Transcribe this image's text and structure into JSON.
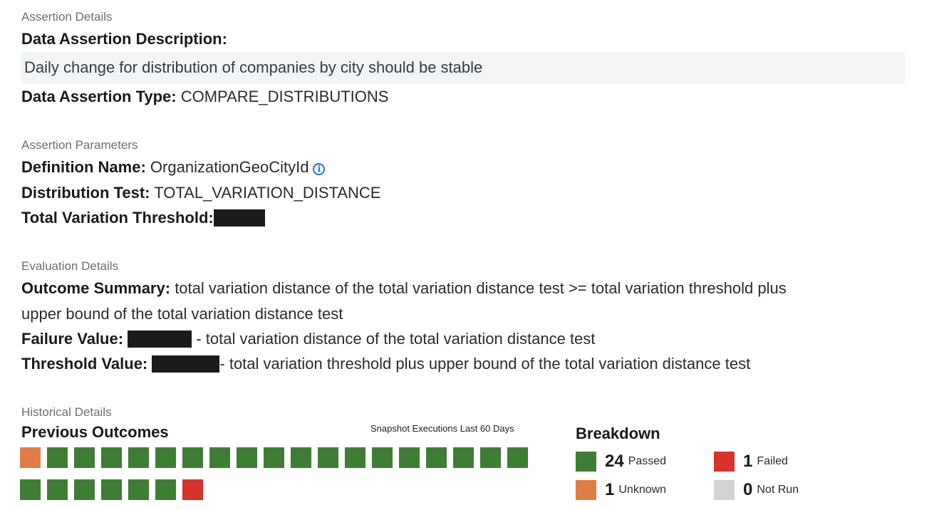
{
  "assertion": {
    "section_label": "Assertion Details",
    "description_label": "Data Assertion Description:",
    "description_text": "Daily change for distribution of companies by city should be stable",
    "type_label": "Data Assertion Type:",
    "type_value": "COMPARE_DISTRIBUTIONS"
  },
  "parameters": {
    "section_label": "Assertion Parameters",
    "definition_label": "Definition Name:",
    "definition_value": "OrganizationGeoCityId",
    "info_icon": "info-icon",
    "dist_label": "Distribution Test:",
    "dist_value": "TOTAL_VARIATION_DISTANCE",
    "threshold_label": "Total Variation Threshold:"
  },
  "evaluation": {
    "section_label": "Evaluation Details",
    "summary_label": "Outcome Summary:",
    "summary_value": "total variation distance of the total variation distance test >= total variation threshold plus",
    "summary_value_cont": "upper bound of the total variation distance test",
    "failure_label": "Failure Value:",
    "failure_value": "- total variation distance of the total variation distance test",
    "threshold_label": "Threshold Value:",
    "threshold_value": "- total variation threshold plus upper bound of the total variation distance test"
  },
  "history": {
    "section_label": "Historical Details",
    "title": "Previous Outcomes",
    "snapshot_label": "Snapshot Executions Last 60 Days",
    "outcomes": [
      "unknown",
      "passed",
      "passed",
      "passed",
      "passed",
      "passed",
      "passed",
      "passed",
      "passed",
      "passed",
      "passed",
      "passed",
      "passed",
      "passed",
      "passed",
      "passed",
      "passed",
      "passed",
      "passed",
      "passed",
      "passed",
      "passed",
      "passed",
      "passed",
      "passed",
      "failed"
    ]
  },
  "breakdown": {
    "title": "Breakdown",
    "passed": {
      "count": "24",
      "label": "Passed"
    },
    "failed": {
      "count": "1",
      "label": "Failed"
    },
    "unknown": {
      "count": "1",
      "label": "Unknown"
    },
    "not_run": {
      "count": "0",
      "label": "Not Run"
    }
  },
  "colors": {
    "passed": "#3f7d35",
    "failed": "#d9312b",
    "unknown": "#e07c45",
    "not_run": "#d2d2d2"
  }
}
